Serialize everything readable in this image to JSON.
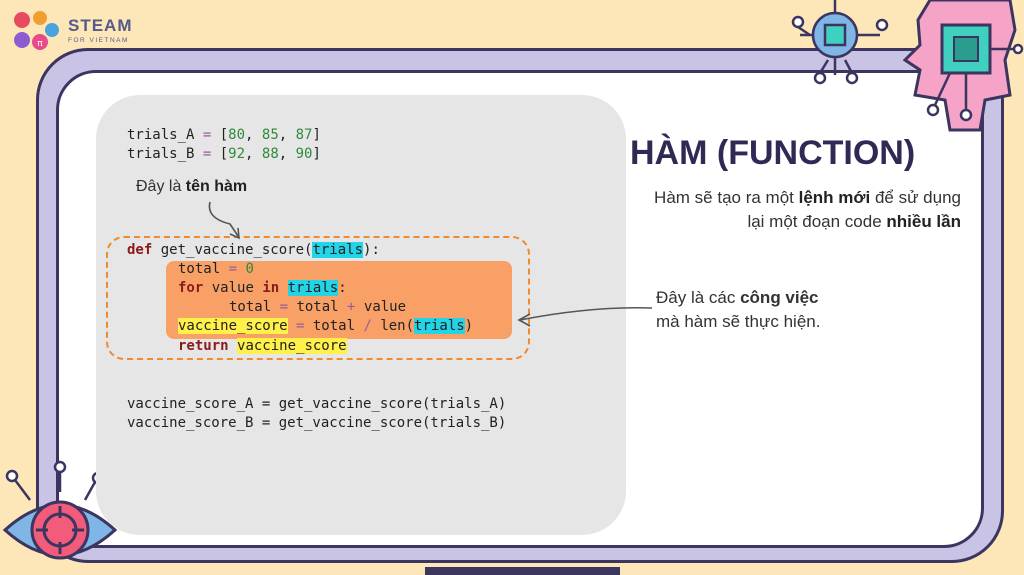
{
  "brand": {
    "name": "STEAM",
    "tagline": "FOR VIETNAM"
  },
  "slide": {
    "title": "HÀM (FUNCTION)",
    "description": {
      "part1": "Hàm sẽ tạo ra một ",
      "bold1": "lệnh mới",
      "part2": " để sử dụng lại một đoạn code ",
      "bold2": "nhiều lần"
    },
    "name_label": {
      "text": "Đây là ",
      "bold": "tên hàm"
    },
    "body_label": {
      "text": "Đây là các ",
      "bold": "công việc",
      "text2": "mà hàm sẽ thực hiện."
    }
  },
  "code": {
    "line1_var": "trials_A",
    "line1_op": " = ",
    "line1_vals": [
      "80",
      "85",
      "87"
    ],
    "line2_var": "trials_B",
    "line2_op": " = ",
    "line2_vals": [
      "92",
      "88",
      "90"
    ],
    "def_kw": "def",
    "func_name": " get_vaccine_score(",
    "param": "trials",
    "def_end": "):",
    "total_init_var": "total",
    "total_init_op": " = ",
    "total_init_val": "0",
    "for_kw": "for",
    "for_var": " value ",
    "in_kw": "in",
    "for_iter": "trials",
    "for_colon": ":",
    "acc_left": "total",
    "acc_eq": " = ",
    "acc_mid": "total ",
    "acc_plus": "+",
    "acc_right": " value",
    "score_var": "vaccine_score",
    "score_eq": " = ",
    "score_mid": "total ",
    "score_div": "/",
    "score_len": " len(",
    "score_param": "trials",
    "score_close": ")",
    "return_kw": "return",
    "return_val": "vaccine_score",
    "call_a": "vaccine_score_A = get_vaccine_score(trials_A)",
    "call_b": "vaccine_score_B = get_vaccine_score(trials_B)"
  },
  "colors": {
    "background": "#fde7b8",
    "frame": "#c9c3e6",
    "frame_border": "#3b3560",
    "highlight_cyan": "#22d4e8",
    "highlight_yellow": "#fff14a",
    "body_box": "#f9a066",
    "dashed_border": "#f08a2c",
    "title": "#2f2a55"
  }
}
